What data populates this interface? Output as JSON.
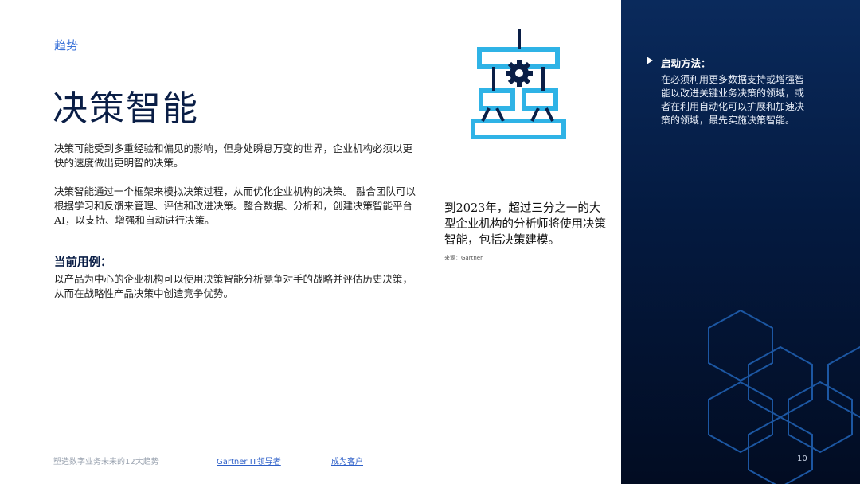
{
  "section_label": "趋势",
  "title": "决策智能",
  "paragraph1": "决策可能受到多重经验和偏见的影响，但身处瞬息万变的世界，企业机构必须以更快的速度做出更明智的决策。",
  "paragraph2": "决策智能通过一个框架来模拟决策过程，从而优化企业机构的决策。 融合团队可以根据学习和反馈来管理、评估和改进决策。整合数据、分析和，创建决策智能平台AI，以支持、增强和自动进行决策。",
  "use_case": {
    "heading": "当前用例：",
    "text": "以产品为中心的企业机构可以使用决策智能分析竞争对手的战略并评估历史决策，从而在战略性产品决策中创造竞争优势。"
  },
  "stat": {
    "text": "到2023年，超过三分之一的大型企业机构的分析师将使用决策智能，包括决策建模。",
    "source": "来源：Gartner"
  },
  "sidebar": {
    "heading": "启动方法：",
    "text": "在必须利用更多数据支持或增强智能以改进关键业务决策的领域，或者在利用自动化可以扩展和加速决策的领域，最先实施决策智能。"
  },
  "footer": {
    "doc_title": "塑造数字业务未来的12大趋势",
    "link1": "Gartner IT领导者",
    "link2": "成为客户",
    "page_number": "10"
  },
  "colors": {
    "accent_blue": "#3a72d8",
    "icon_cyan": "#2fb3e6",
    "title_navy": "#0a1e46",
    "panel_dark": "#041a40"
  },
  "icons": [
    "decision-framework-icon",
    "gear-icon",
    "hexagon-pattern"
  ]
}
